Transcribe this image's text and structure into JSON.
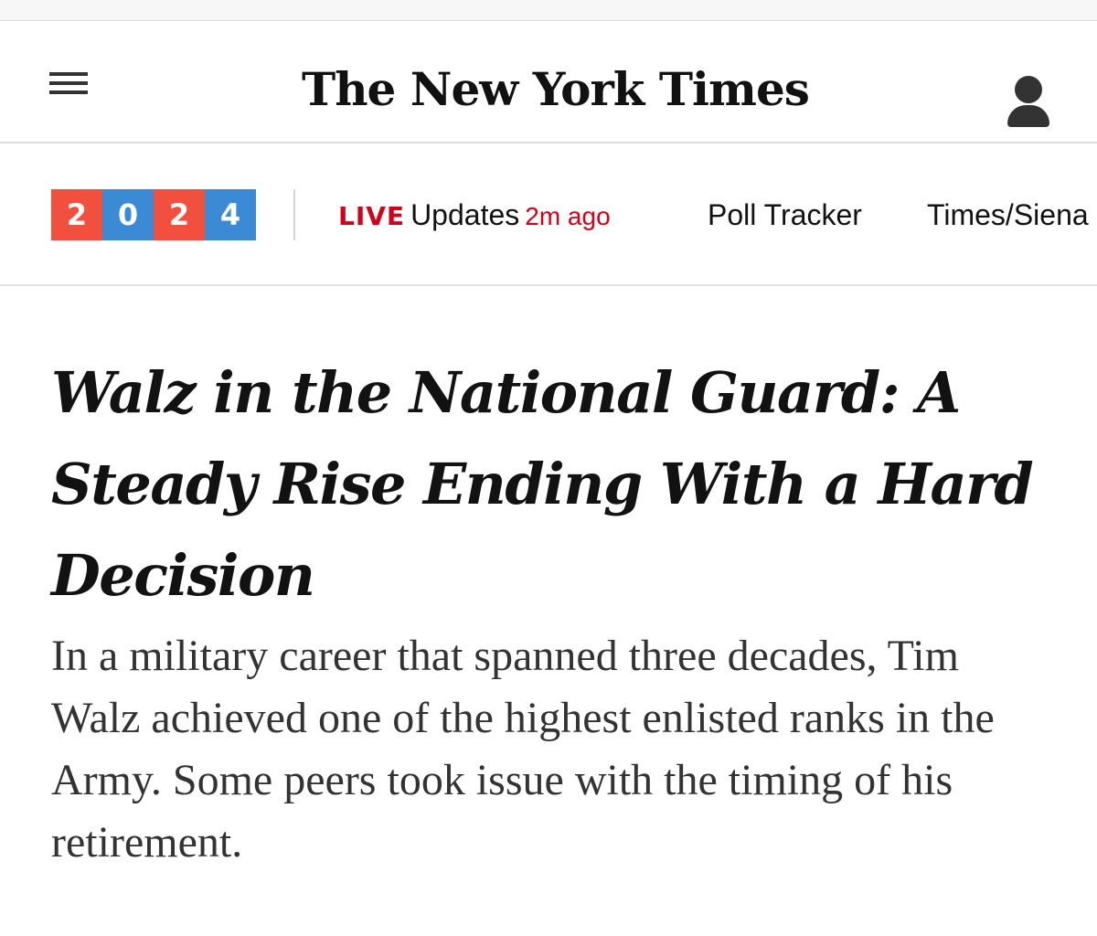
{
  "masthead": {
    "logo_text": "The New York Times"
  },
  "icons": {
    "menu": "hamburger-menu-icon",
    "account": "user-account-icon"
  },
  "subnav": {
    "badge_digits": [
      "2",
      "0",
      "2",
      "4"
    ],
    "badge_colors": [
      "#f1503e",
      "#3a8ad6",
      "#f1503e",
      "#3a8ad6"
    ],
    "live": {
      "label": "LIVE",
      "text": "Updates",
      "time": "2m ago"
    },
    "poll_tracker": "Poll Tracker",
    "times_siena": "Times/Siena"
  },
  "article": {
    "headline": "Walz in the National Guard: A Steady Rise Ending With a Hard Decision",
    "summary": "In a military career that spanned three decades, Tim Walz achieved one of the highest enlisted ranks in the Army. Some peers took issue with the timing of his retirement."
  },
  "colors": {
    "live_red": "#d0021b",
    "text": "#121212"
  }
}
